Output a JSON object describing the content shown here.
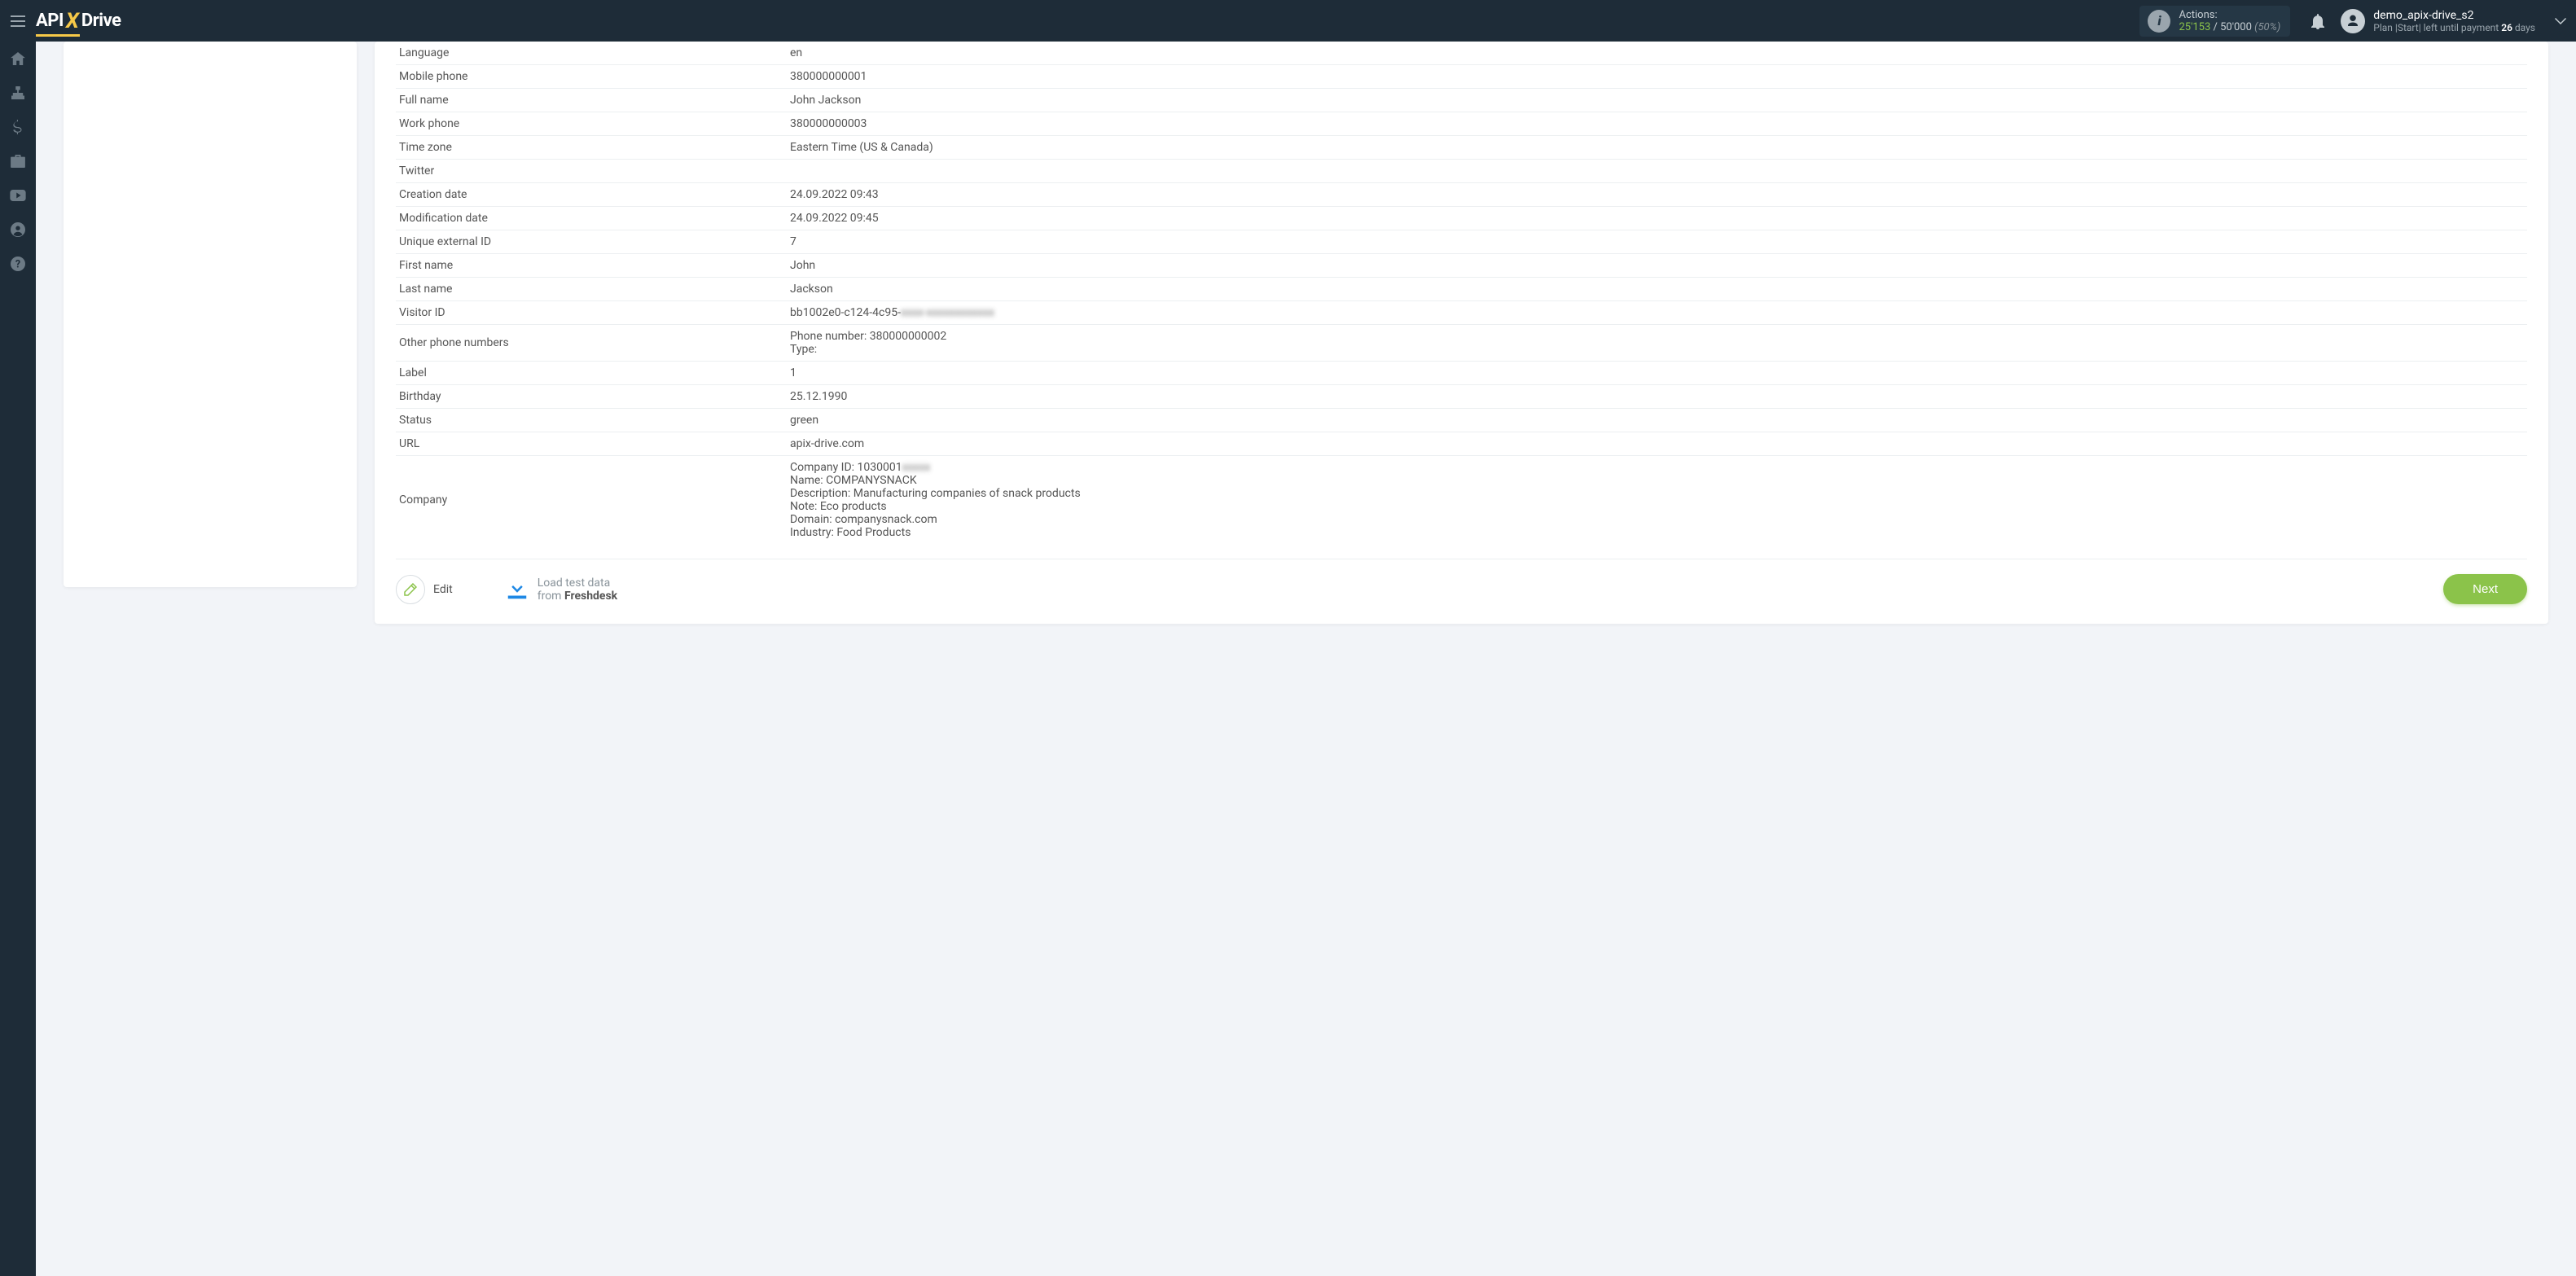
{
  "brand": {
    "part1": "API",
    "x": "X",
    "part2": "Drive"
  },
  "actions": {
    "label": "Actions:",
    "used": "25'153",
    "sep": " / ",
    "limit": "50'000",
    "pct": "(50%)"
  },
  "user": {
    "name": "demo_apix-drive_s2",
    "plan_prefix": "Plan |Start| left until payment ",
    "days": "26",
    "plan_suffix": " days"
  },
  "rows": [
    {
      "key": "Language",
      "value": "en"
    },
    {
      "key": "Mobile phone",
      "value": "380000000001"
    },
    {
      "key": "Full name",
      "value": "John Jackson"
    },
    {
      "key": "Work phone",
      "value": "380000000003"
    },
    {
      "key": "Time zone",
      "value": "Eastern Time (US & Canada)"
    },
    {
      "key": "Twitter",
      "value": ""
    },
    {
      "key": "Creation date",
      "value": "24.09.2022 09:43"
    },
    {
      "key": "Modification date",
      "value": "24.09.2022 09:45"
    },
    {
      "key": "Unique external ID",
      "value": "7"
    },
    {
      "key": "First name",
      "value": "John"
    },
    {
      "key": "Last name",
      "value": "Jackson"
    }
  ],
  "visitor_id": {
    "key": "Visitor ID",
    "prefix": "bb1002e0-c124-4c95-",
    "blurred": "xxxx-xxxxxxxxxxxx"
  },
  "other_phones": {
    "key": "Other phone numbers",
    "line1": "Phone number: 380000000002",
    "line2": "Type:"
  },
  "rows2": [
    {
      "key": "Label",
      "value": "1"
    },
    {
      "key": "Birthday",
      "value": "25.12.1990"
    },
    {
      "key": "Status",
      "value": "green"
    },
    {
      "key": "URL",
      "value": "apix-drive.com"
    }
  ],
  "company": {
    "key": "Company",
    "id_prefix": "Company ID: 1030001",
    "id_blur": "xxxxx",
    "lines": [
      "Name: COMPANYSNACK",
      "Description: Manufacturing companies of snack products",
      "Note: Eco products",
      "Domain: companysnack.com",
      "Industry: Food Products"
    ]
  },
  "footer": {
    "edit": "Edit",
    "load_l1": "Load test data",
    "load_from": "from ",
    "load_src": "Freshdesk",
    "next": "Next"
  }
}
